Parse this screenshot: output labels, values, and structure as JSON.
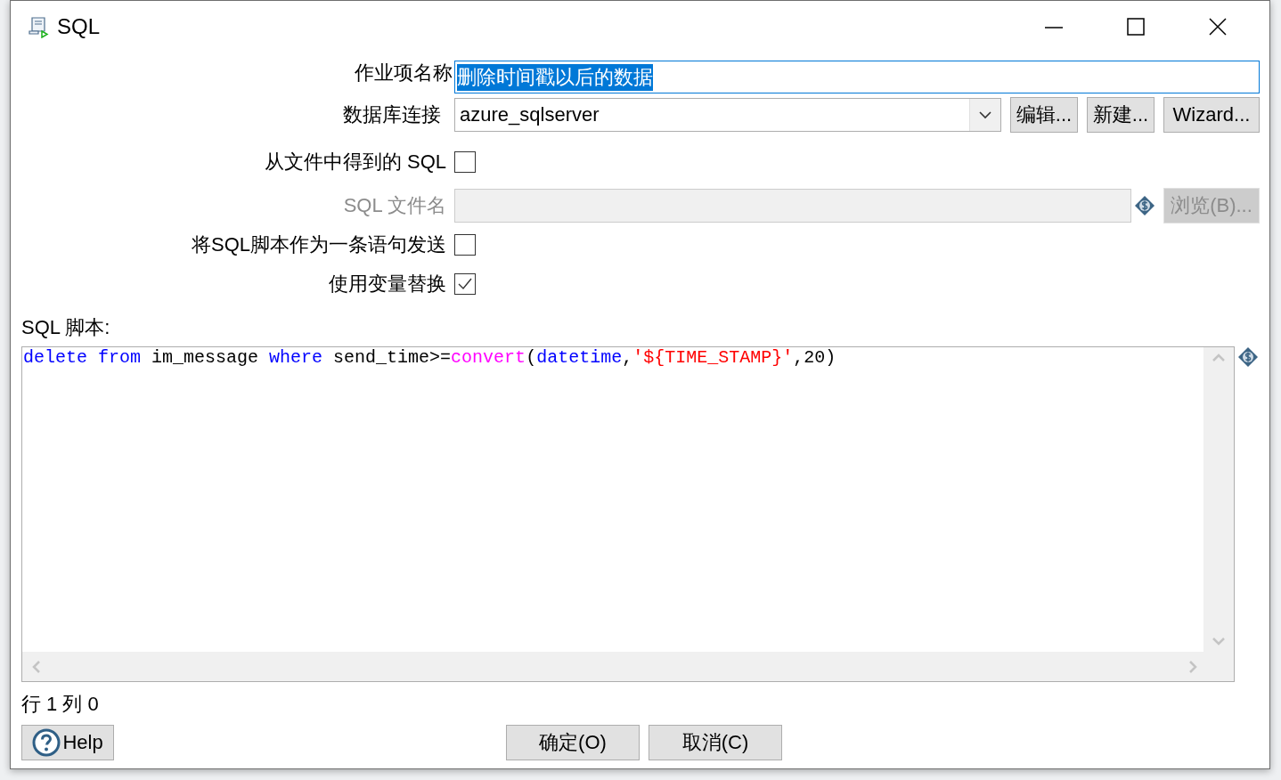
{
  "window": {
    "title": "SQL"
  },
  "step_name": {
    "label": "作业项名称",
    "value": "删除时间戳以后的数据",
    "selected": true
  },
  "connection": {
    "label": "数据库连接",
    "value": "azure_sqlserver",
    "buttons": [
      "编辑...",
      "新建...",
      "Wizard..."
    ]
  },
  "options": [
    {
      "kind": "checkbox",
      "label": "从文件中得到的 SQL",
      "checked": false
    },
    {
      "kind": "file",
      "label": "SQL 文件名",
      "disabled": true,
      "button": "浏览(B)..."
    },
    {
      "kind": "checkbox",
      "label": "将SQL脚本作为一条语句发送",
      "checked": false
    },
    {
      "kind": "checkbox",
      "label": "使用变量替换",
      "checked": true
    }
  ],
  "script": {
    "label": "SQL 脚本:",
    "lines": [
      [
        {
          "kind": "keyword",
          "text": "delete"
        },
        {
          "kind": "keyword",
          "text": " from"
        },
        {
          "kind": "plain",
          "text": " im_message "
        },
        {
          "kind": "keyword",
          "text": "where"
        },
        {
          "kind": "plain",
          "text": " send_time>="
        },
        {
          "kind": "function",
          "text": "convert"
        },
        {
          "kind": "plain",
          "text": "("
        },
        {
          "kind": "keyword",
          "text": "datetime"
        },
        {
          "kind": "plain",
          "text": ","
        },
        {
          "kind": "string",
          "text": "'${TIME_STAMP}'"
        },
        {
          "kind": "plain",
          "text": ",20)"
        }
      ]
    ]
  },
  "status_bar": "行 1 列 0",
  "buttons": {
    "help": "Help",
    "ok": "确定(O)",
    "cancel": "取消(C)"
  }
}
